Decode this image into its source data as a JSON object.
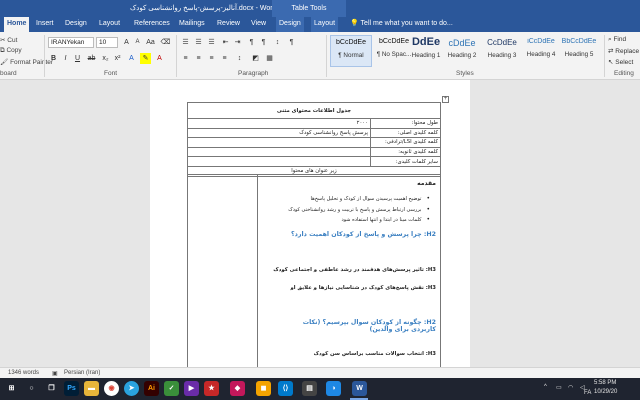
{
  "window": {
    "title": "آنالیز-پرسش-پاسخ روانشناسی کودک.docx - Word",
    "table_tools": "Table Tools"
  },
  "tabs": [
    "Home",
    "Insert",
    "Design",
    "Layout",
    "References",
    "Mailings",
    "Review",
    "View",
    "Design",
    "Layout"
  ],
  "tell_me": "Tell me what you want to do...",
  "ribbon": {
    "clipboard": {
      "items": [
        "Cut",
        "Copy",
        "Format Painter"
      ],
      "label": "board"
    },
    "font": {
      "name": "IRANYekan",
      "size": "10",
      "label": "Font"
    },
    "paragraph": {
      "label": "Paragraph"
    },
    "styles": {
      "label": "Styles",
      "items": [
        {
          "sample": "bCcDdEe",
          "name": "¶ Normal"
        },
        {
          "sample": "bCcDdEe",
          "name": "¶ No Spac..."
        },
        {
          "sample": "DdEe",
          "name": "Heading 1"
        },
        {
          "sample": "cDdEe",
          "name": "Heading 2"
        },
        {
          "sample": "CcDdEe",
          "name": "Heading 3"
        },
        {
          "sample": "iCcDdEe",
          "name": "Heading 4"
        },
        {
          "sample": "BbCcDdEe",
          "name": "Heading 5"
        }
      ]
    },
    "editing": {
      "items": [
        "Find",
        "Replace",
        "Select"
      ],
      "label": "Editing"
    }
  },
  "document": {
    "table_title": "جدول اطلاعات محتوای متنی",
    "rows": [
      {
        "key": "طول محتوا:",
        "value": "۲۰۰۰"
      },
      {
        "key": "کلمه کلیدی اصلی:",
        "value": "پرسش پاسخ روانشناسی کودک"
      },
      {
        "key": "کلمه کلیدی LSI/ترادفی:",
        "value": ""
      },
      {
        "key": "کلمه کلیدی ثانویه:",
        "value": ""
      },
      {
        "key": "سایر کلمات کلیدی:",
        "value": ""
      }
    ],
    "subtitle": "زیر عنوان های محتوا",
    "intro": "مقدمه",
    "bullets": [
      "توضیح اهمیت پرسیدن سوال از کودک و تحلیل پاسخ‌ها",
      "بررسی ارتباط پرسش و پاسخ با تربیت و رشد روانشناختی کودک",
      "کلمات مینا در ابتدا و انتها استفاده شود"
    ],
    "h2_1": "H2: چرا پرسش و پاسخ از کودکان اهمیت دارد؟",
    "h3_1": "H3: تاثیر پرسش‌های هدفمند در رشد عاطفی و اجتماعی کودک",
    "h3_2": "H3: نقش پاسخ‌های کودک در شناسایی نیازها و علایق او",
    "h2_2": "H2: چگونه از کودکان سوال بپرسیم؟ (نکات کاربردی برای والدین)",
    "h3_3": "H3: انتخاب سوالات مناسب براساس سن کودک"
  },
  "status": {
    "words": "1346 words",
    "language": "Persian (Iran)"
  },
  "taskbar": {
    "time": "5:58 PM",
    "date": "10/29/20",
    "lang": "FA",
    "icons": [
      "windows-icon",
      "search-icon",
      "task-view-icon",
      "photoshop-icon",
      "folder-icon",
      "chrome-icon",
      "telegram-icon",
      "ai-icon",
      "vector-icon",
      "media-icon",
      "app-icon",
      "vscode-icon",
      "word-icon"
    ]
  }
}
